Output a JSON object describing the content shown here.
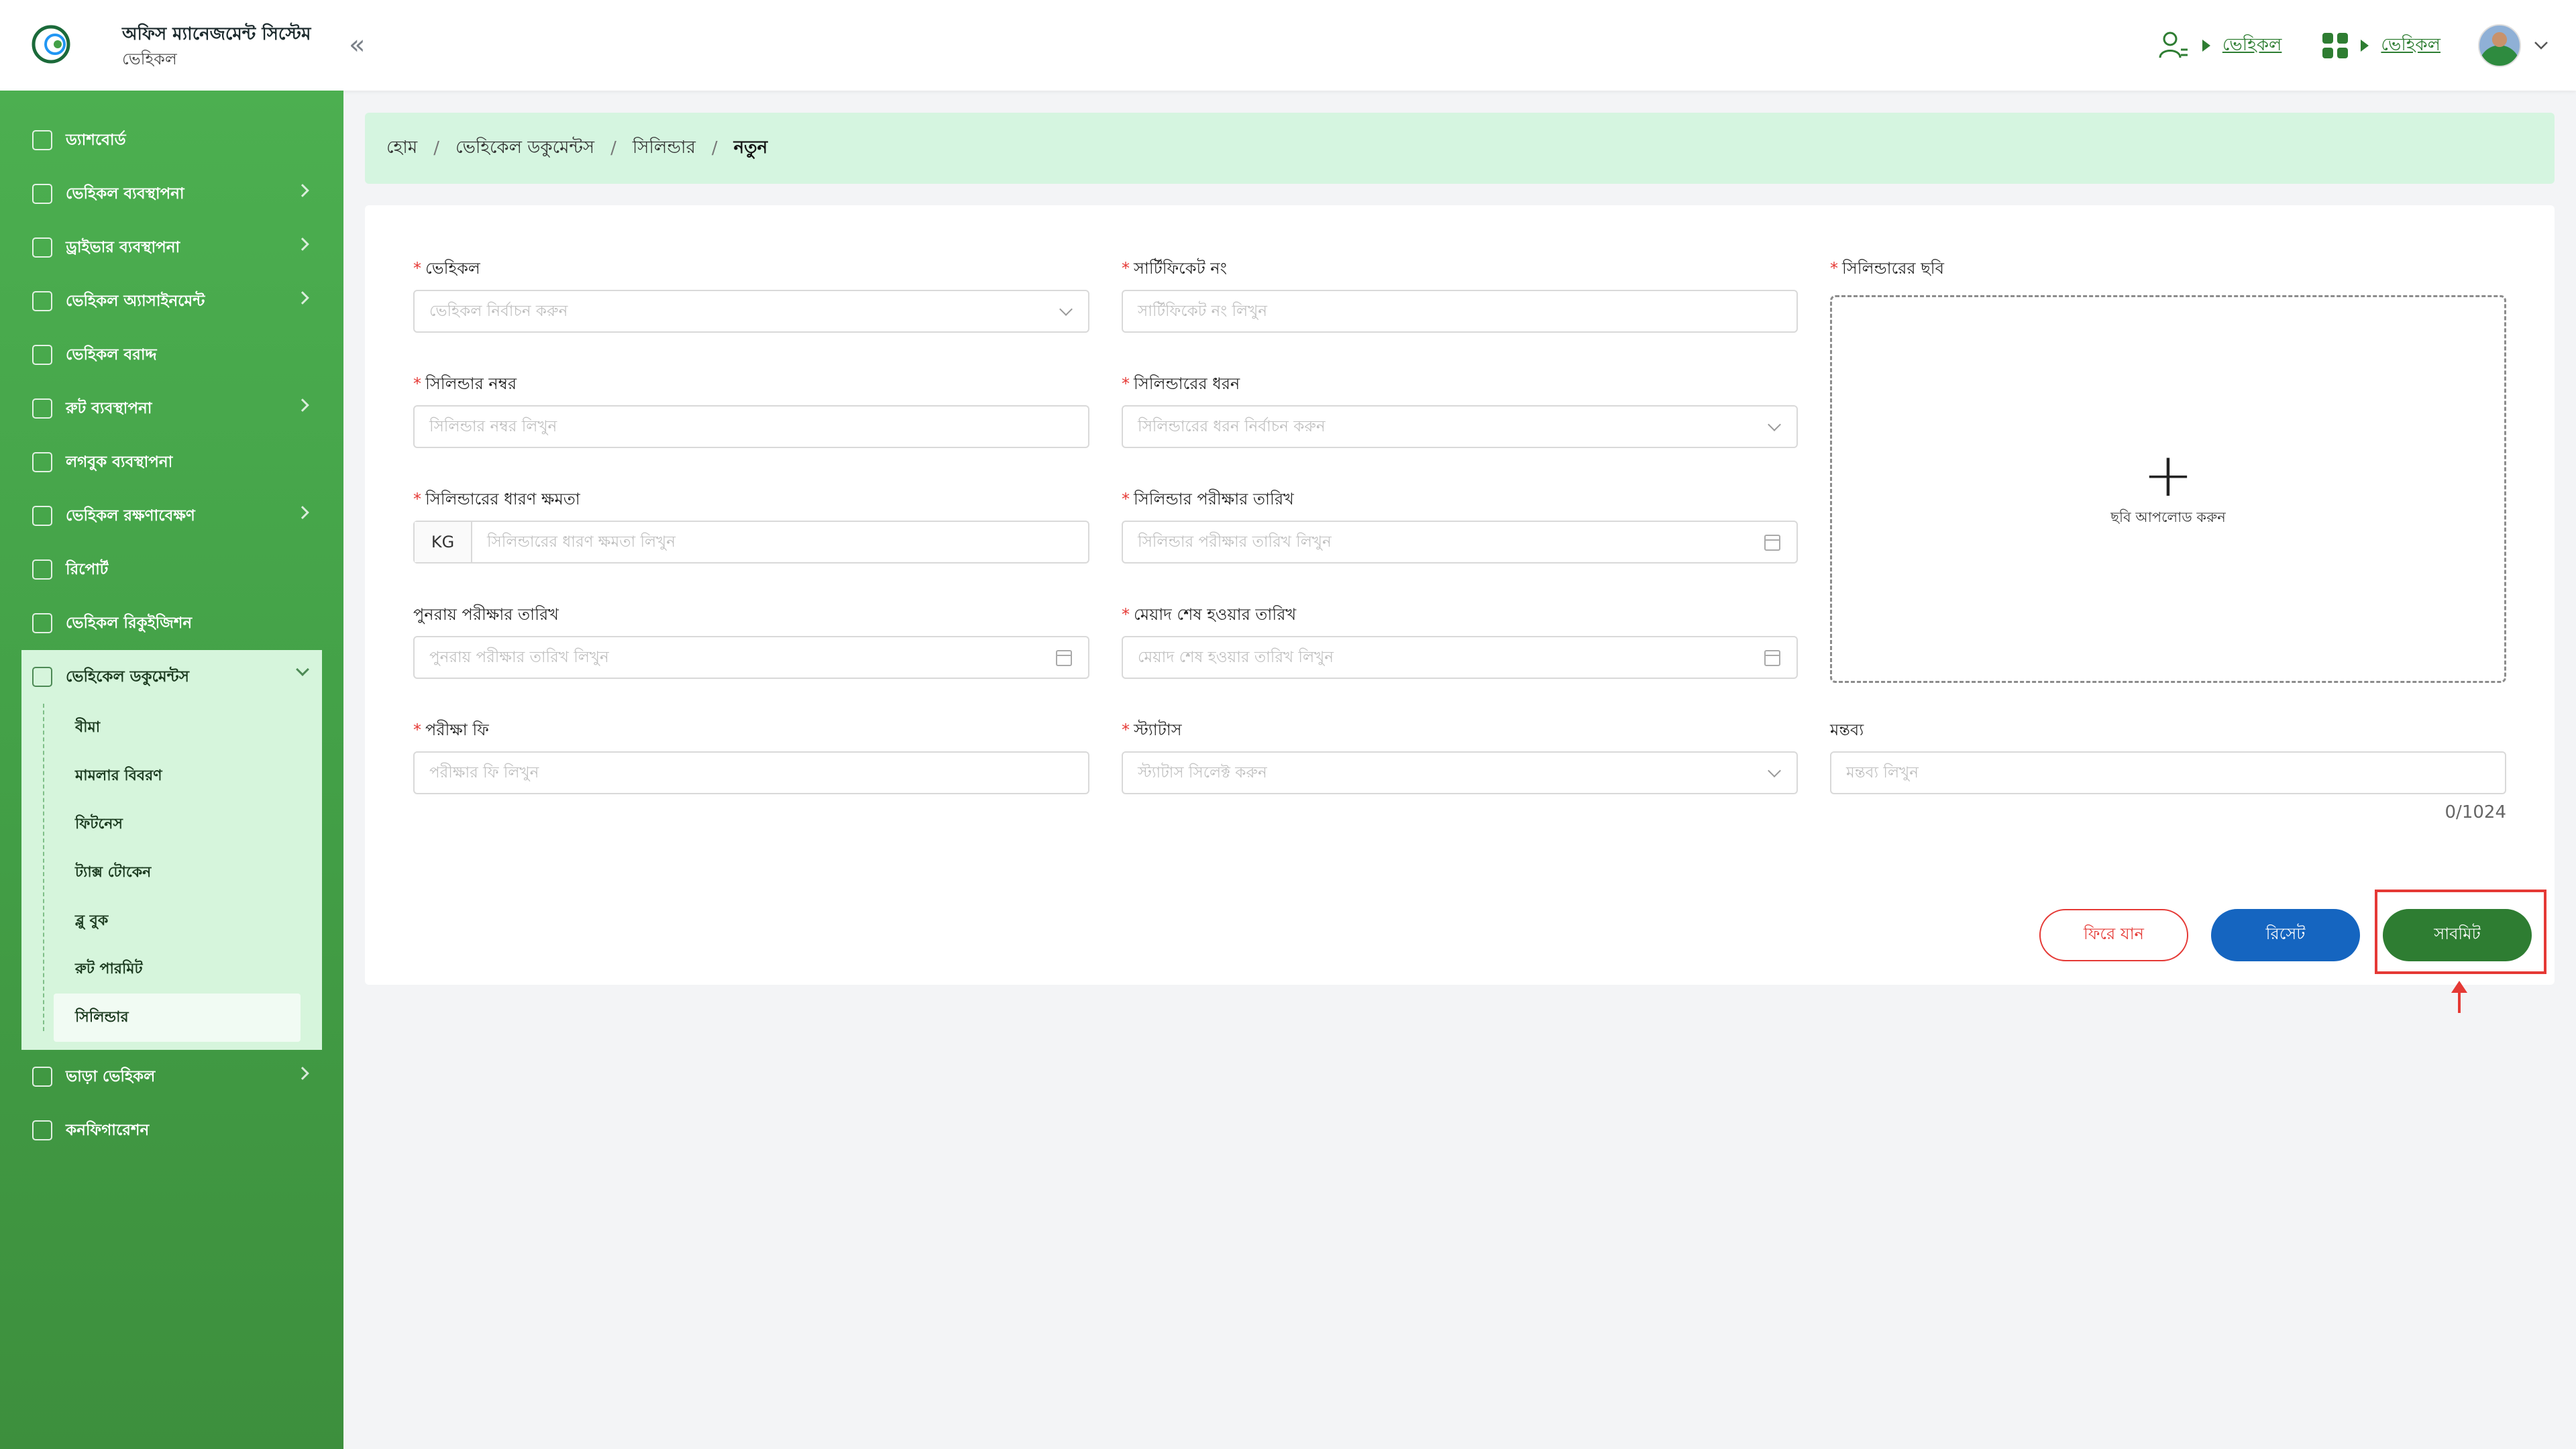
{
  "header": {
    "app_title": "অফিস ম্যানেজমেন্ট সিস্টেম",
    "app_subtitle": "ভেহিকল",
    "collapse_icon": "«",
    "links": [
      "ভেহিকল",
      "ভেহিকল"
    ],
    "icons": [
      "user-switch-icon",
      "apps-grid-icon",
      "avatar",
      "chevron-down-icon"
    ]
  },
  "sidebar": {
    "items": [
      {
        "label": "ড্যাশবোর্ড",
        "has_arrow": false
      },
      {
        "label": "ভেহিকল ব্যবস্থাপনা",
        "has_arrow": true
      },
      {
        "label": "ড্রাইভার ব্যবস্থাপনা",
        "has_arrow": true
      },
      {
        "label": "ভেহিকল অ্যাসাইনমেন্ট",
        "has_arrow": true
      },
      {
        "label": "ভেহিকল বরাদ্দ",
        "has_arrow": false
      },
      {
        "label": "রুট ব্যবস্থাপনা",
        "has_arrow": true
      },
      {
        "label": "লগবুক ব্যবস্থাপনা",
        "has_arrow": false
      },
      {
        "label": "ভেহিকল রক্ষণাবেক্ষণ",
        "has_arrow": true
      },
      {
        "label": "রিপোর্ট",
        "has_arrow": false
      },
      {
        "label": "ভেহিকল রিকুইজিশন",
        "has_arrow": false
      }
    ],
    "open_group": {
      "label": "ভেহিকেল ডকুমেন্টস",
      "children": [
        "বীমা",
        "মামলার বিবরণ",
        "ফিটনেস",
        "ট্যাক্স টোকেন",
        "ব্লু বুক",
        "রুট পারমিট",
        "সিলিন্ডার"
      ],
      "active": "সিলিন্ডার"
    },
    "bottom_items": [
      {
        "label": "ভাড়া ভেহিকল",
        "has_arrow": true
      },
      {
        "label": "কনফিগারেশন",
        "has_arrow": false
      }
    ]
  },
  "breadcrumb": [
    "হোম",
    "ভেহিকেল ডকুমেন্টস",
    "সিলিন্ডার",
    "নতুন"
  ],
  "form": {
    "vehicle": {
      "label": "ভেহিকল",
      "placeholder": "ভেহিকল নির্বাচন করুন",
      "required": true
    },
    "certificate_no": {
      "label": "সার্টিফিকেট নং",
      "placeholder": "সার্টিফিকেট নং লিখুন",
      "required": true
    },
    "cylinder_image": {
      "label": "সিলিন্ডারের ছবি",
      "upload_text": "ছবি আপলোড করুন",
      "required": true
    },
    "cylinder_number": {
      "label": "সিলিন্ডার নম্বর",
      "placeholder": "সিলিন্ডার নম্বর লিখুন",
      "required": true
    },
    "cylinder_type": {
      "label": "সিলিন্ডারের ধরন",
      "placeholder": "সিলিন্ডারের ধরন নির্বাচন করুন",
      "required": true
    },
    "capacity": {
      "label": "সিলিন্ডারের ধারণ ক্ষমতা",
      "unit": "KG",
      "placeholder": "সিলিন্ডারের ধারণ ক্ষমতা লিখুন",
      "required": true
    },
    "test_date": {
      "label": "সিলিন্ডার পরীক্ষার তারিখ",
      "placeholder": "সিলিন্ডার পরীক্ষার তারিখ লিখুন",
      "required": true
    },
    "retest_date": {
      "label": "পুনরায় পরীক্ষার তারিখ",
      "placeholder": "পুনরায় পরীক্ষার তারিখ লিখুন",
      "required": false
    },
    "expiry_date": {
      "label": "মেয়াদ শেষ হওয়ার তারিখ",
      "placeholder": "মেয়াদ শেষ হওয়ার তারিখ লিখুন",
      "required": true
    },
    "test_fee": {
      "label": "পরীক্ষা ফি",
      "placeholder": "পরীক্ষার ফি লিখুন",
      "required": true
    },
    "status": {
      "label": "স্ট্যাটাস",
      "placeholder": "স্ট্যাটাস সিলেক্ট করুন",
      "required": true
    },
    "remarks": {
      "label": "মন্তব্য",
      "placeholder": "মন্তব্য লিখুন",
      "required": false,
      "counter": "0/1024"
    }
  },
  "buttons": {
    "back": "ফিরে যান",
    "reset": "রিসেট",
    "submit": "সাবমিট"
  },
  "colors": {
    "sidebar": "#4caf50",
    "breadcrumb_bg": "#d5f5e0",
    "submit": "#2e7d32",
    "reset": "#1565c0",
    "back": "#e53935",
    "highlight": "#e53935"
  }
}
